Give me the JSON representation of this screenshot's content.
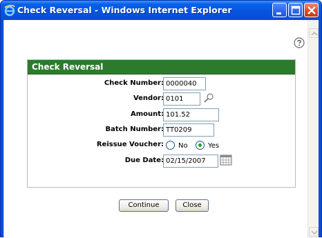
{
  "window": {
    "title": "Check Reversal - Windows Internet Explorer"
  },
  "panel": {
    "title": "Check Reversal"
  },
  "form": {
    "check_number": {
      "label": "Check Number:",
      "value": "0000040"
    },
    "vendor": {
      "label": "Vendor:",
      "value": "0101"
    },
    "amount": {
      "label": "Amount:",
      "value": "101.52"
    },
    "batch_number": {
      "label": "Batch Number:",
      "value": "TT0209"
    },
    "reissue_voucher": {
      "label": "Reissue Voucher:",
      "options": [
        "No",
        "Yes"
      ],
      "selected": "Yes"
    },
    "due_date": {
      "label": "Due Date:",
      "value": "02/15/2007"
    }
  },
  "buttons": {
    "continue": "Continue",
    "close": "Close"
  },
  "colors": {
    "title_bar": "#0654e0",
    "panel_header": "#2d7a2d",
    "close_button": "#e04b2a"
  },
  "icons": {
    "browser": "internet-explorer-icon",
    "help": "help-icon",
    "vendor_lookup": "magnifier-icon",
    "date_picker": "calendar-icon"
  }
}
